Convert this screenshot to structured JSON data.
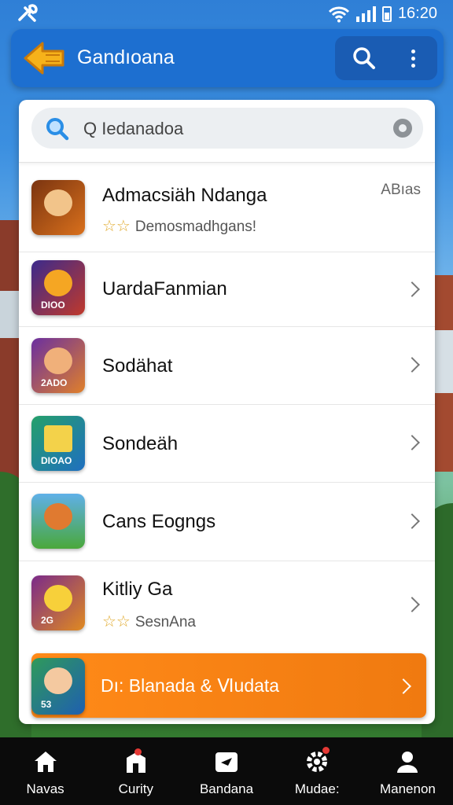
{
  "status": {
    "time": "16:20",
    "left_icon": "tools-icon",
    "right_icons": [
      "wifi-icon",
      "signal-icon",
      "battery-icon"
    ]
  },
  "appbar": {
    "title": "Gandıoana",
    "back_icon": "back-arrow-icon",
    "actions": [
      "search-icon",
      "more-vert-icon"
    ],
    "color": "#1d6fd0"
  },
  "search": {
    "value": "Q Iedanadoa",
    "icon": "search-icon",
    "clear_icon": "clear-icon"
  },
  "items": [
    {
      "title": "Admacsiäh Ndanga",
      "subtitle": "Demosmadhgans!",
      "stars": "☆☆",
      "right": "ABıas"
    },
    {
      "title": "UardaFanmian"
    },
    {
      "title": "Sodähat"
    },
    {
      "title": "Sondeäh"
    },
    {
      "title": "Cans Eogngs"
    },
    {
      "title": "Kitliy Ga",
      "subtitle": "SesnAna",
      "stars": "☆☆"
    }
  ],
  "thumb_tags": [
    "",
    "DIOO",
    "2ADO",
    "DIOAO",
    "",
    "2G"
  ],
  "promo": {
    "text": "Dı: Blanada & Ⅵudata",
    "tag": "53",
    "color": "#ff8a18"
  },
  "nav": [
    {
      "label": "Navas",
      "icon": "home-icon"
    },
    {
      "label": "Curity",
      "icon": "store-icon"
    },
    {
      "label": "Bandana",
      "icon": "video-icon"
    },
    {
      "label": "Mudae:",
      "icon": "settings-icon"
    },
    {
      "label": "Manenon",
      "icon": "profile-icon"
    }
  ]
}
